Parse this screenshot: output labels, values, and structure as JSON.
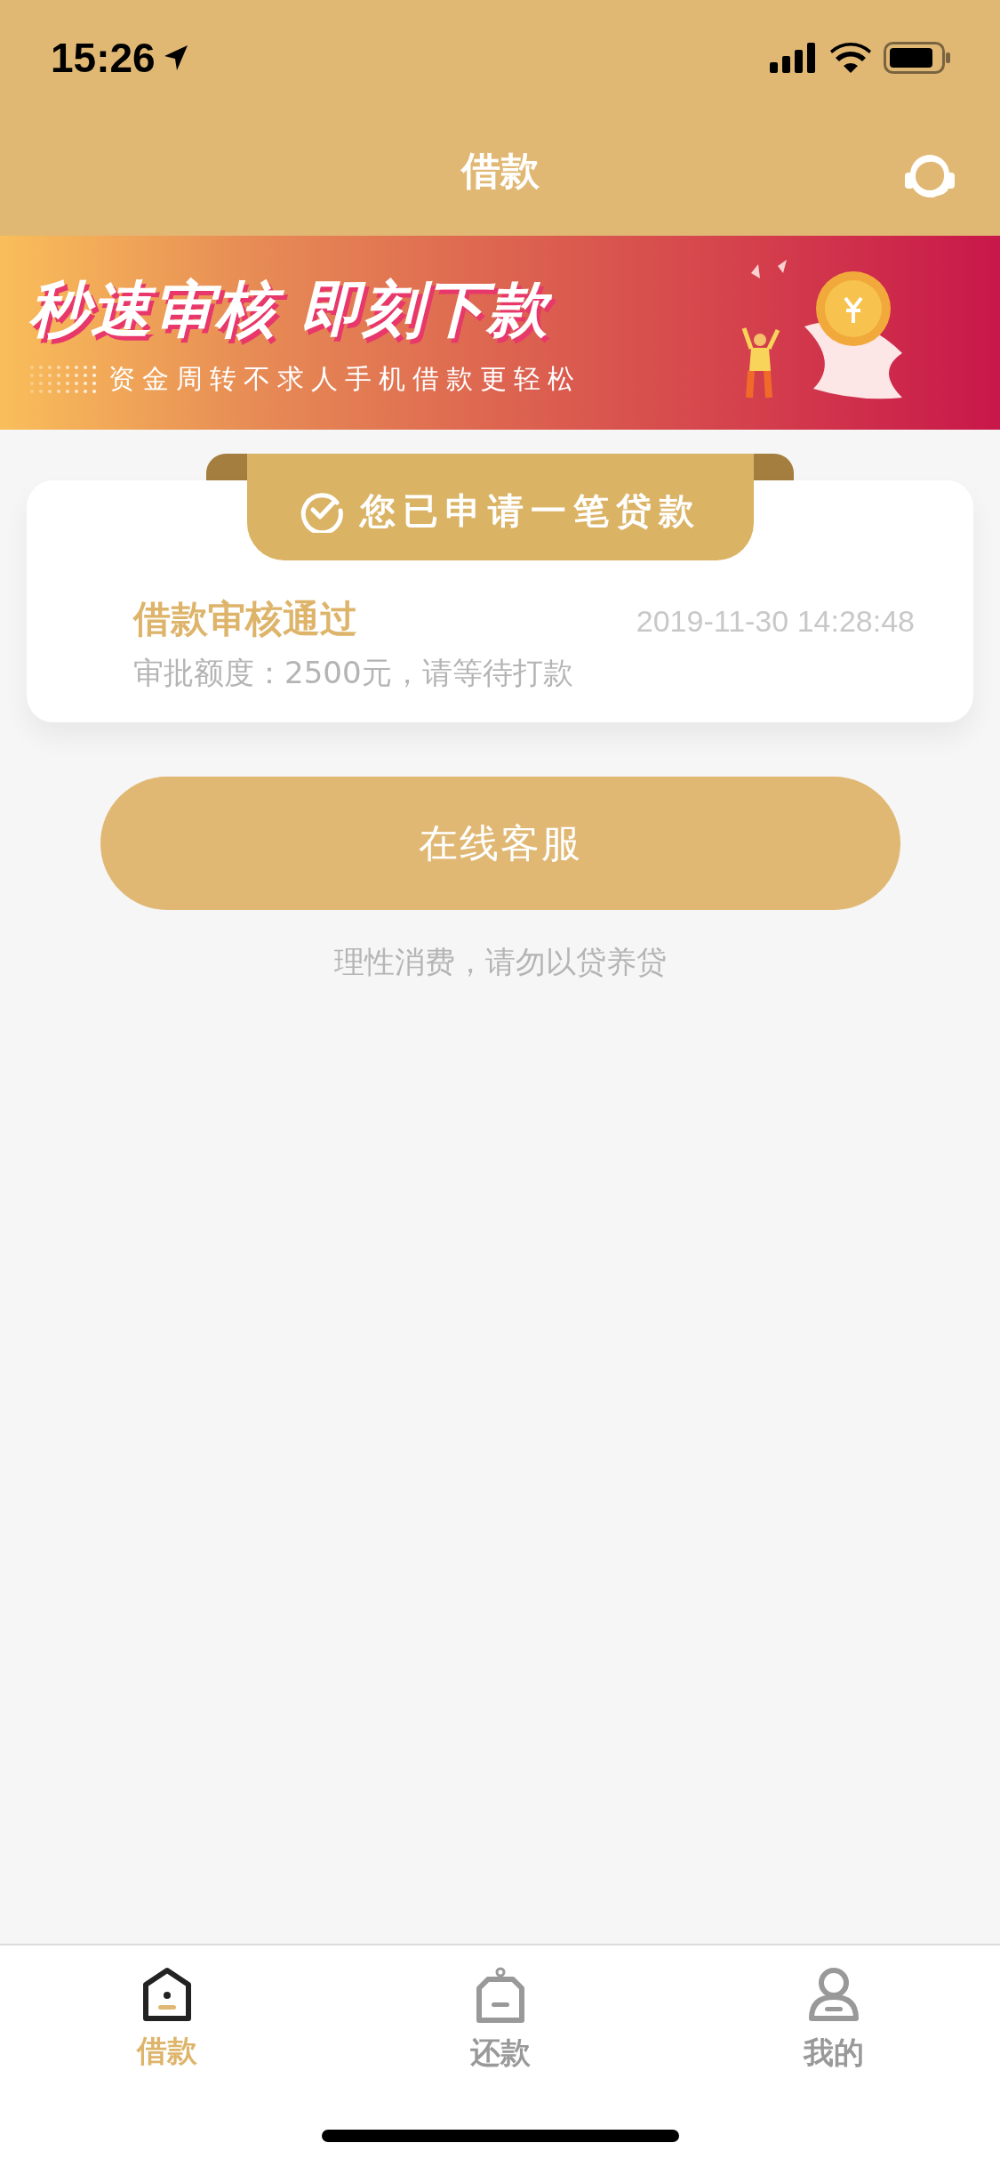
{
  "status_bar": {
    "time": "15:26"
  },
  "header": {
    "title": "借款"
  },
  "banner": {
    "headline": "秒速审核 即刻下款",
    "subtitle": "资金周转不求人手机借款更轻松"
  },
  "application_card": {
    "ribbon": "您已申请一笔贷款",
    "status": "借款审核通过",
    "timestamp": "2019-11-30 14:28:48",
    "detail": "审批额度：2500元，请等待打款"
  },
  "service_button": {
    "label": "在线客服"
  },
  "notice": "理性消费，请勿以贷养贷",
  "tab_bar": [
    {
      "label": "借款",
      "selected": true,
      "kind": "house"
    },
    {
      "label": "还款",
      "selected": false,
      "kind": "bag"
    },
    {
      "label": "我的",
      "selected": false,
      "kind": "person"
    }
  ]
}
